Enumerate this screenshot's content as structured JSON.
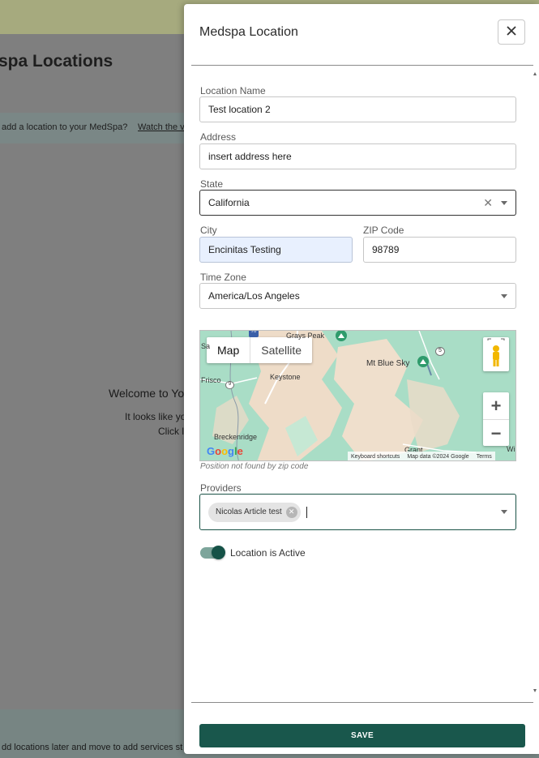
{
  "background": {
    "page_title": "spa Locations",
    "banner_text": "add a location to your MedSpa?",
    "banner_link": "Watch the v",
    "welcome_title": "Welcome to Yo",
    "welcome_line1": "It looks like yo",
    "welcome_line2": "Click l",
    "footer_text": "dd locations later and move to add services st"
  },
  "drawer": {
    "title": "Medspa Location",
    "close_label": "✕",
    "fields": {
      "location_name": {
        "label": "Location Name",
        "value": "Test location 2"
      },
      "address": {
        "label": "Address",
        "value": "insert address here"
      },
      "state": {
        "label": "State",
        "value": "California"
      },
      "city": {
        "label": "City",
        "value": "Encinitas Testing"
      },
      "zip": {
        "label": "ZIP Code",
        "value": "98789"
      },
      "time_zone": {
        "label": "Time Zone",
        "value": "America/Los Angeles"
      }
    },
    "map": {
      "type_buttons": [
        "Map",
        "Satellite"
      ],
      "places": {
        "grays_peak": "Grays Peak",
        "mt_blue_sky": "Mt Blue Sky",
        "keystone": "Keystone",
        "frisco": "Frisco",
        "breckenridge": "Breckenridge",
        "grant": "Grant",
        "sa": "Sa",
        "wi": "Wi",
        "route_70": "70",
        "route_9": "9",
        "route_5": "5"
      },
      "logo": "Google",
      "attribution": [
        "Keyboard shortcuts",
        "Map data ©2024 Google",
        "Terms"
      ],
      "zoom_in": "+",
      "zoom_out": "−"
    },
    "map_note": "Position not found by zip code",
    "providers": {
      "label": "Providers",
      "chips": [
        "Nicolas Article test"
      ]
    },
    "active_toggle": {
      "label": "Location is Active",
      "on": true
    },
    "save_label": "SAVE"
  },
  "colors": {
    "primary": "#19574c",
    "toggle_track": "#7da59b",
    "autofill": "#e8f0fe"
  }
}
